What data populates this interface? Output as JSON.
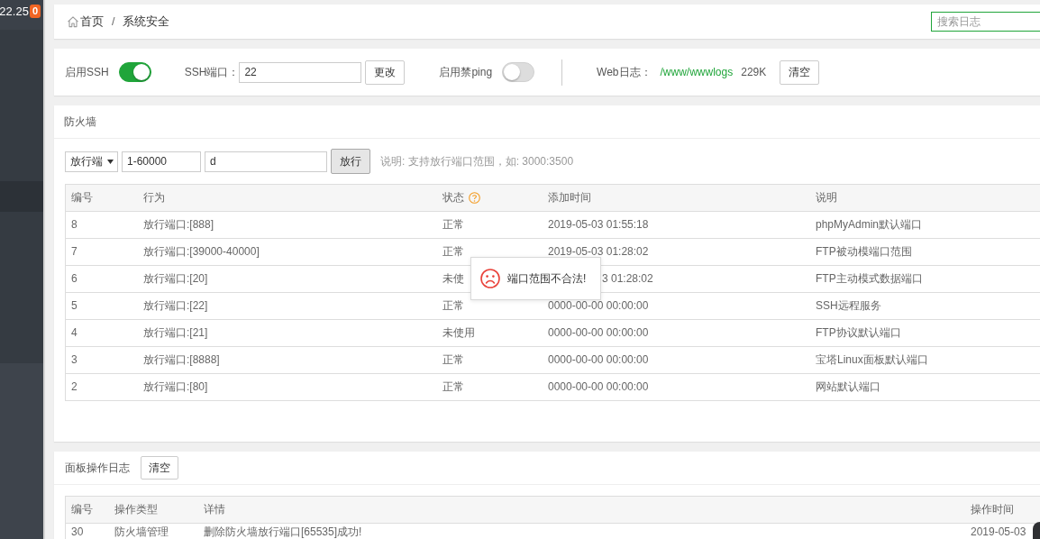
{
  "sidebar": {
    "version": "22.25",
    "badge": "0",
    "has_selected_item": true
  },
  "breadcrumb": {
    "separator": "/",
    "items": [
      {
        "label": "首页",
        "kind": "home"
      },
      {
        "label": "系统安全",
        "kind": "current"
      }
    ]
  },
  "search": {
    "placeholder": "搜索日志"
  },
  "settings": {
    "ssh": {
      "label": "启用SSH",
      "on": true
    },
    "ssh_port": {
      "label": "SSH端口：",
      "value": "22",
      "button": "更改"
    },
    "ping": {
      "label": "启用禁ping",
      "on": false
    },
    "web_log": {
      "label": "Web日志：",
      "path": "/www/wwwlogs",
      "size": "229K",
      "button": "清空"
    }
  },
  "firewall": {
    "title": "防火墙",
    "form": {
      "type_select": "放行端",
      "port": "1-60000",
      "remark": "d",
      "button": "放行",
      "hint": "说明: 支持放行端口范围，如: 3000:3500"
    },
    "table": {
      "columns": [
        {
          "label": "编号",
          "help": false
        },
        {
          "label": "行为",
          "help": false
        },
        {
          "label": "状态",
          "help": true
        },
        {
          "label": "添加时间",
          "help": false
        },
        {
          "label": "说明",
          "help": false
        }
      ],
      "rows": [
        [
          "8",
          "放行端口:[888]",
          "正常",
          "2019-05-03 01:55:18",
          "phpMyAdmin默认端口"
        ],
        [
          "7",
          "放行端口:[39000-40000]",
          "正常",
          "2019-05-03 01:28:02",
          "FTP被动模端口范围"
        ],
        [
          "6",
          "放行端口:[20]",
          "未使",
          "3 01:28:02",
          "FTP主动模式数据端口"
        ],
        [
          "5",
          "放行端口:[22]",
          "正常",
          "0000-00-00 00:00:00",
          "SSH远程服务"
        ],
        [
          "4",
          "放行端口:[21]",
          "未使用",
          "0000-00-00 00:00:00",
          "FTP协议默认端口"
        ],
        [
          "3",
          "放行端口:[8888]",
          "正常",
          "0000-00-00 00:00:00",
          "宝塔Linux面板默认端口"
        ],
        [
          "2",
          "放行端口:[80]",
          "正常",
          "0000-00-00 00:00:00",
          "网站默认端口"
        ]
      ]
    },
    "toast": {
      "kind": "error",
      "message": "端口范围不合法!"
    }
  },
  "operation_log": {
    "title": "面板操作日志",
    "button": "清空",
    "table": {
      "columns": [
        "编号",
        "操作类型",
        "详情",
        "操作时间"
      ],
      "rows": [
        [
          "30",
          "防火墙管理",
          "删除防火墙放行端口[65535]成功!",
          "2019-05-03"
        ]
      ]
    }
  }
}
